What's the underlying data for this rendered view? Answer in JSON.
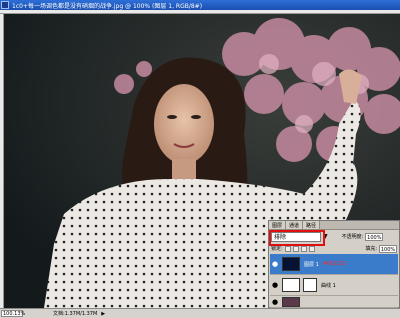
{
  "window": {
    "title": "1c0+每一场调色都是没有硝烟的战争.jpg @ 100% (图层 1, RGB/8#)"
  },
  "statusbar": {
    "zoom": "100.13%",
    "doc_info": "文档:1.37M/1.37M",
    "arrow": "▶"
  },
  "layers_panel": {
    "tabs": [
      "图层",
      "通道",
      "路径"
    ],
    "blend_mode": "排除",
    "opacity_label": "不透明度:",
    "opacity_value": "100%",
    "lock_label": "锁定:",
    "fill_label": "填充:",
    "fill_value": "100%",
    "layers": [
      {
        "name": "图层 1",
        "color_note": "#061232",
        "selected": true
      },
      {
        "name": "曲线 1",
        "selected": false
      },
      {
        "name": "",
        "selected": false
      }
    ]
  },
  "colors": {
    "title_bar": "#1a4fb0",
    "selected_layer": "#3a7cc9",
    "highlight_outline": "#e01010",
    "layer_fill_color": "#061232"
  }
}
